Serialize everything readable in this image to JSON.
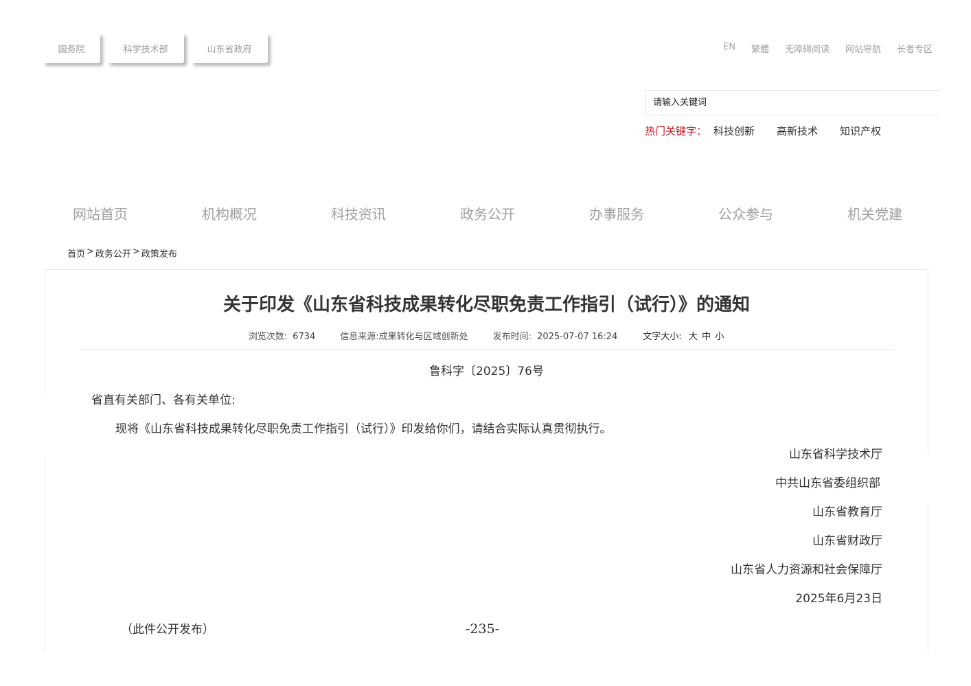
{
  "top_links": [
    "国务院",
    "科学技术部",
    "山东省政府"
  ],
  "util_links": [
    "EN",
    "繁體",
    "无障碍阅读",
    "网站导航",
    "长者专区"
  ],
  "search": {
    "placeholder": "请输入关键词"
  },
  "hot_keywords": {
    "label": "热门关键字：",
    "items": [
      "科技创新",
      "高新技术",
      "知识产权"
    ]
  },
  "nav": [
    "网站首页",
    "机构概况",
    "科技资讯",
    "政务公开",
    "办事服务",
    "公众参与",
    "机关党建"
  ],
  "breadcrumb": [
    "首页",
    "政务公开",
    "政策发布"
  ],
  "breadcrumb_sep": ">",
  "article": {
    "title": "关于印发《山东省科技成果转化尽职免责工作指引（试行）》的通知",
    "meta": {
      "views_label": "浏览次数:",
      "views_value": "6734",
      "source_label": "信息来源:",
      "source_value": "成果转化与区域创新处",
      "time_label": "发布时间:",
      "time_value": "2025-07-07 16:24",
      "font_label": "文字大小:",
      "font_sizes": [
        "大",
        "中",
        "小"
      ]
    },
    "doc_number": "鲁科字〔2025〕76号",
    "salutation": "省直有关部门、各有关单位:",
    "body": "现将《山东省科技成果转化尽职免责工作指引（试行）》印发给你们，请结合实际认真贯彻执行。",
    "signers": [
      "山东省科学技术厅",
      "中共山东省委组织部",
      "山东省教育厅",
      "山东省财政厅",
      "山东省人力资源和社会保障厅",
      "2025年6月23日"
    ],
    "footnote": "（此件公开发布）",
    "page_number": "-235-"
  }
}
